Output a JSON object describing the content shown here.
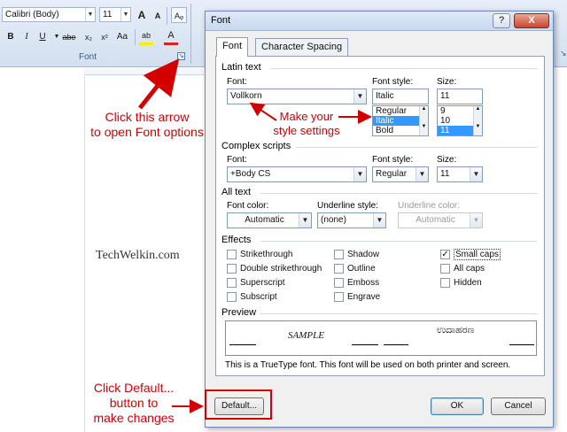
{
  "ribbon": {
    "font_name": "Calibri (Body)",
    "font_size": "11",
    "group_label": "Font",
    "buttons": {
      "grow": "A",
      "shrink": "A",
      "clear": "Aᵩ",
      "bold": "B",
      "italic": "I",
      "underline": "U",
      "strike": "abe",
      "subscript": "x₂",
      "superscript": "x²",
      "change_case": "Aa",
      "highlight": "ab",
      "font_color": "A"
    }
  },
  "document": {
    "watermark": "TechWelkin.com"
  },
  "annotations": {
    "click_arrow": "Click this arrow\nto open Font options",
    "style_settings": "Make your\nstyle settings",
    "click_default": "Click Default...\nbutton to\nmake changes"
  },
  "dialog": {
    "title": "Font",
    "help": "?",
    "close": "X",
    "tabs": [
      "Font",
      "Character Spacing"
    ],
    "latin": {
      "heading": "Latin text",
      "font_label": "Font:",
      "font_value": "Vollkorn",
      "style_label": "Font style:",
      "style_value": "Italic",
      "style_options": [
        "Regular",
        "Italic",
        "Bold"
      ],
      "style_selected": "Italic",
      "size_label": "Size:",
      "size_value": "11",
      "size_options": [
        "9",
        "10",
        "11"
      ],
      "size_selected": "11"
    },
    "complex": {
      "heading": "Complex scripts",
      "font_label": "Font:",
      "font_value": "+Body CS",
      "style_label": "Font style:",
      "style_value": "Regular",
      "size_label": "Size:",
      "size_value": "11"
    },
    "all_text": {
      "heading": "All text",
      "font_color_label": "Font color:",
      "font_color_value": "Automatic",
      "underline_label": "Underline style:",
      "underline_value": "(none)",
      "underline_color_label": "Underline color:",
      "underline_color_value": "Automatic"
    },
    "effects": {
      "heading": "Effects",
      "items": [
        {
          "label": "Strikethrough",
          "checked": false
        },
        {
          "label": "Double strikethrough",
          "checked": false
        },
        {
          "label": "Superscript",
          "checked": false
        },
        {
          "label": "Subscript",
          "checked": false
        },
        {
          "label": "Shadow",
          "checked": false
        },
        {
          "label": "Outline",
          "checked": false
        },
        {
          "label": "Emboss",
          "checked": false
        },
        {
          "label": "Engrave",
          "checked": false
        },
        {
          "label": "Small caps",
          "checked": true
        },
        {
          "label": "All caps",
          "checked": false
        },
        {
          "label": "Hidden",
          "checked": false
        }
      ]
    },
    "preview": {
      "heading": "Preview",
      "sample": "SAMPLE",
      "sample_complex": "ಉದಾಹರಣ",
      "note": "This is a TrueType font. This font will be used on both printer and screen."
    },
    "buttons": {
      "default": "Default...",
      "ok": "OK",
      "cancel": "Cancel"
    }
  },
  "colors": {
    "annotation": "#d40000",
    "selection": "#3399ff"
  }
}
